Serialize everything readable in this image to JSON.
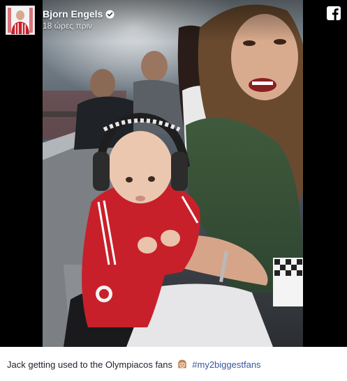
{
  "post": {
    "author": {
      "name": "Bjorn Engels",
      "verified": true,
      "avatar_icon": "player-avatar-icon"
    },
    "timestamp": "18 ώρες πριν",
    "platform_icon": "facebook-icon",
    "caption": {
      "text": "Jack getting used to the Olympiacos fans",
      "emoji_icon": "woman-emoji-icon",
      "hashtag": "#my2biggestfans"
    }
  },
  "colors": {
    "media_background": "#000000",
    "hashtag": "#365899",
    "caption_text": "#1d2129",
    "verified_badge": "#ffffff"
  }
}
